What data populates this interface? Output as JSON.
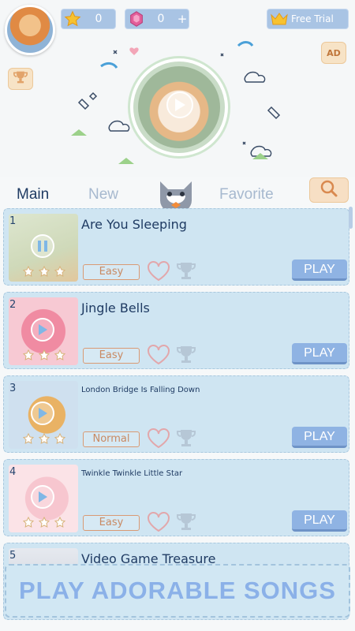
{
  "header": {
    "stars_count": "0",
    "gems_count": "0",
    "gems_plus": "+",
    "trial_label": "Free Trial",
    "ad_label": "AD",
    "icons": [
      "avatar",
      "star-icon",
      "gem-icon",
      "crown-icon",
      "trophy-icon",
      "play-icon"
    ]
  },
  "tabs": {
    "main": "Main",
    "new": "New",
    "favorite": "Favorite",
    "active": "Main"
  },
  "songs": [
    {
      "number": "1",
      "title": "Are You Sleeping",
      "difficulty": "Easy",
      "play_label": "PLAY",
      "state": "paused"
    },
    {
      "number": "2",
      "title": "Jingle Bells",
      "difficulty": "Easy",
      "play_label": "PLAY",
      "state": "play"
    },
    {
      "number": "3",
      "title": "London Bridge Is Falling Down",
      "difficulty": "Normal",
      "play_label": "PLAY",
      "state": "play"
    },
    {
      "number": "4",
      "title": "Twinkle Twinkle Little Star",
      "difficulty": "Easy",
      "play_label": "PLAY",
      "state": "play"
    },
    {
      "number": "5",
      "title": "Video Game Treasure",
      "difficulty": "",
      "play_label": "",
      "state": "play"
    }
  ],
  "banner": {
    "text": "PLAY ADORABLE SONGS"
  },
  "colors": {
    "card_bg": "#cfe5f2",
    "play_button": "#8fb3e3",
    "difficulty_text": "#c98a63",
    "banner_text": "#8bb1e8",
    "title_text": "#1f3b63"
  }
}
